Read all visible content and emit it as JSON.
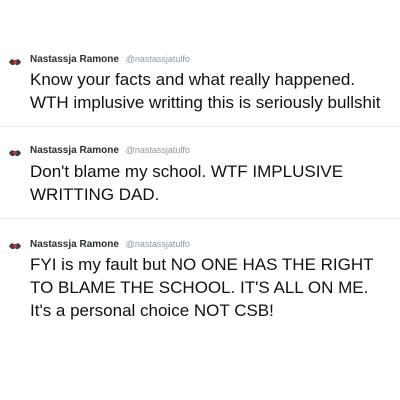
{
  "tweets": [
    {
      "author": "Nastassja Ramone",
      "handle": "@nastassjatulfo",
      "avatar_icon": "avatar-icon",
      "text": "Know your facts and what really happened.\nWTH implusive writting this is seriously bullshit"
    },
    {
      "author": "Nastassja Ramone",
      "handle": "@nastassjatulfo",
      "avatar_icon": "avatar-icon",
      "text": "Don't blame my school. WTF IMPLUSIVE\nWRITTING DAD."
    },
    {
      "author": "Nastassja Ramone",
      "handle": "@nastassjatulfo",
      "avatar_icon": "avatar-icon",
      "text": "FYI is my fault but NO ONE HAS THE RIGHT\nTO BLAME THE SCHOOL. IT'S ALL ON ME.\nIt's a personal choice NOT CSB!"
    }
  ],
  "colors": {
    "name": "#292f33",
    "handle": "#8899a6",
    "text": "#111111",
    "separator": "#e4e8eb"
  }
}
